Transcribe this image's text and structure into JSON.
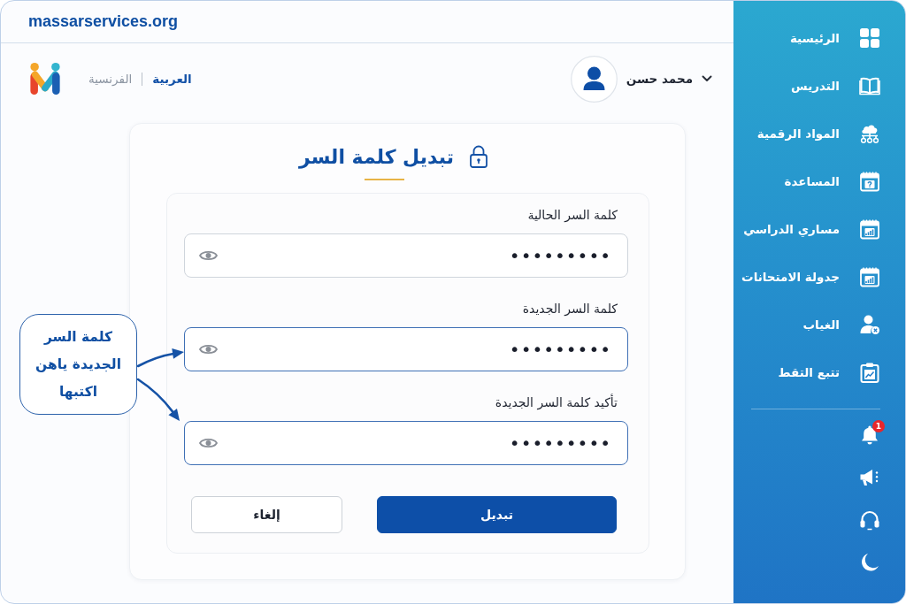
{
  "header": {
    "site": "massarservices.org"
  },
  "topbar": {
    "languages": [
      {
        "label": "العربية",
        "selected": true
      },
      {
        "label": "الفرنسية",
        "selected": false
      }
    ],
    "user": {
      "name": "محمد حسن"
    }
  },
  "sidebar": {
    "items": [
      {
        "label": "الرئيسية"
      },
      {
        "label": "التدريس"
      },
      {
        "label": "المواد الرقمية"
      },
      {
        "label": "المساعدة"
      },
      {
        "label": "مساري الدراسي"
      },
      {
        "label": "جدولة الامتحانات"
      },
      {
        "label": "الغياب"
      },
      {
        "label": "تتبع التقط"
      }
    ],
    "notification_count": "1"
  },
  "form": {
    "title": "تبديل كلمة السر",
    "fields": [
      {
        "label": "كلمة السر الحالية",
        "value": "•••••••••",
        "highlighted": false
      },
      {
        "label": "كلمة السر الجديدة",
        "value": "•••••••••",
        "highlighted": true
      },
      {
        "label": "تأكيد كلمة السر الجديدة",
        "value": "•••••••••",
        "highlighted": true
      }
    ],
    "buttons": [
      {
        "label": "تبديل",
        "kind": "primary"
      },
      {
        "label": "إلغاء",
        "kind": "secondary"
      }
    ]
  },
  "callout": {
    "text": "كلمة السر\nالجديدة ياهن\nاكتبها"
  }
}
